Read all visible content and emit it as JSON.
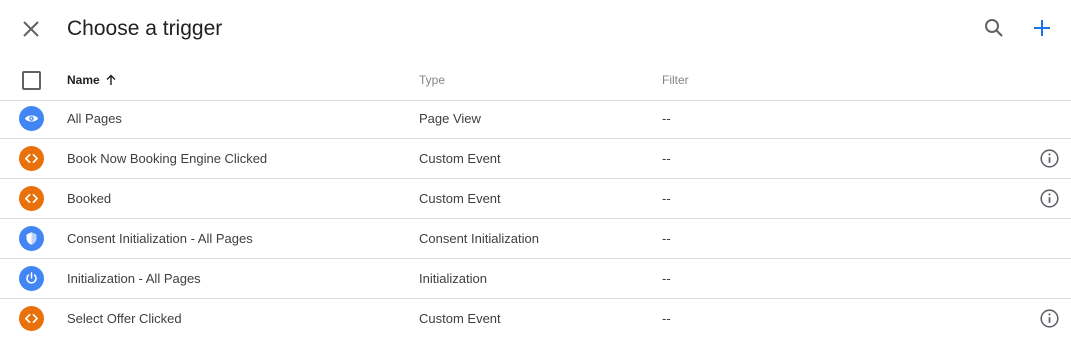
{
  "header": {
    "title": "Choose a trigger"
  },
  "columns": {
    "name": "Name",
    "type": "Type",
    "filter": "Filter"
  },
  "colors": {
    "blue": "#4285f4",
    "orange": "#e8710a",
    "accent": "#1a73e8"
  },
  "rows": [
    {
      "name": "All Pages",
      "type": "Page View",
      "filter": "--",
      "icon": "eye-icon",
      "color": "#4285f4",
      "info": false
    },
    {
      "name": "Book Now Booking Engine Clicked",
      "type": "Custom Event",
      "filter": "--",
      "icon": "code-icon",
      "color": "#e8710a",
      "info": true
    },
    {
      "name": "Booked",
      "type": "Custom Event",
      "filter": "--",
      "icon": "code-icon",
      "color": "#e8710a",
      "info": true
    },
    {
      "name": "Consent Initialization - All Pages",
      "type": "Consent Initialization",
      "filter": "--",
      "icon": "shield-icon",
      "color": "#4285f4",
      "info": false
    },
    {
      "name": "Initialization - All Pages",
      "type": "Initialization",
      "filter": "--",
      "icon": "power-icon",
      "color": "#4285f4",
      "info": false
    },
    {
      "name": "Select Offer Clicked",
      "type": "Custom Event",
      "filter": "--",
      "icon": "code-icon",
      "color": "#e8710a",
      "info": true
    }
  ]
}
